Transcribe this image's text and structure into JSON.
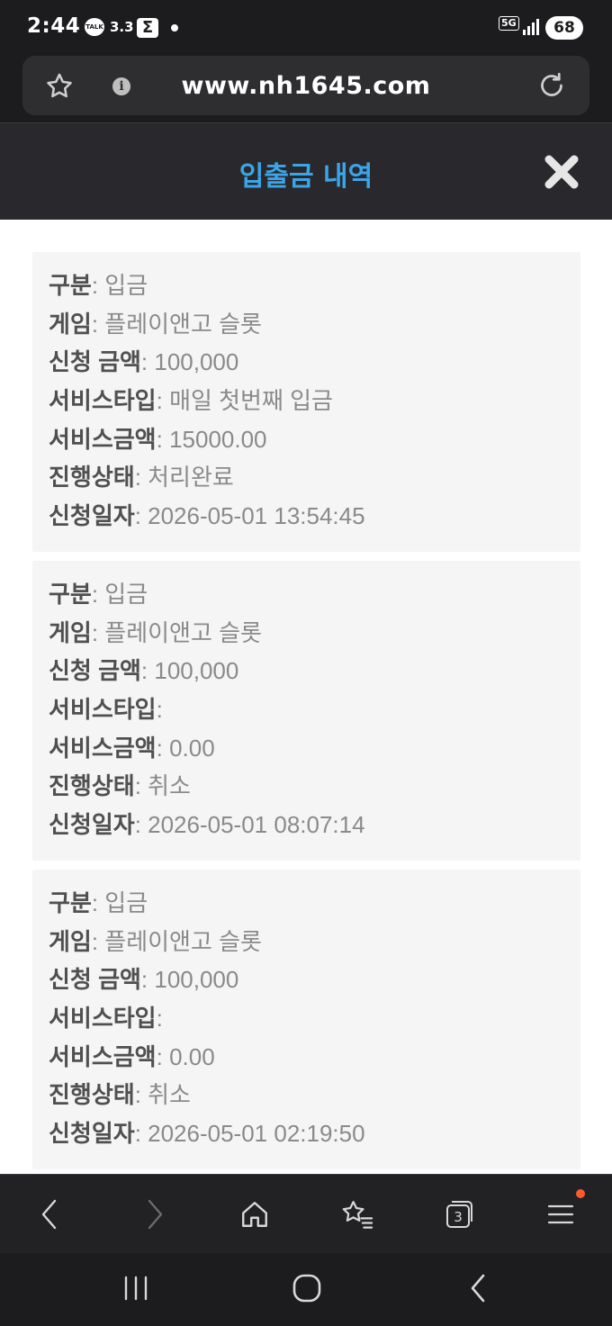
{
  "status_bar": {
    "time": "2:44",
    "talk_label": "TALK",
    "speed": "3.3",
    "sigma": "Σ",
    "network": "5G",
    "battery": "68"
  },
  "browser": {
    "url": "www.nh1645.com",
    "open_tabs": "3"
  },
  "header": {
    "title": "입출금 내역"
  },
  "labels": {
    "type": "구분",
    "game": "게임",
    "amount": "신청 금액",
    "service_type": "서비스타입",
    "service_amount": "서비스금액",
    "status": "진행상태",
    "date": "신청일자"
  },
  "records": [
    {
      "type": "입금",
      "game": "플레이앤고 슬롯",
      "amount": "100,000",
      "service_type": "매일 첫번째 입금",
      "service_amount": "15000.00",
      "status": "처리완료",
      "date": "2026-05-01 13:54:45"
    },
    {
      "type": "입금",
      "game": "플레이앤고 슬롯",
      "amount": "100,000",
      "service_type": "",
      "service_amount": "0.00",
      "status": "취소",
      "date": "2026-05-01 08:07:14"
    },
    {
      "type": "입금",
      "game": "플레이앤고 슬롯",
      "amount": "100,000",
      "service_type": "",
      "service_amount": "0.00",
      "status": "취소",
      "date": "2026-05-01 02:19:50"
    }
  ],
  "colors": {
    "title_blue": "#3aa5e8",
    "notification_dot": "#ff5a2b"
  }
}
